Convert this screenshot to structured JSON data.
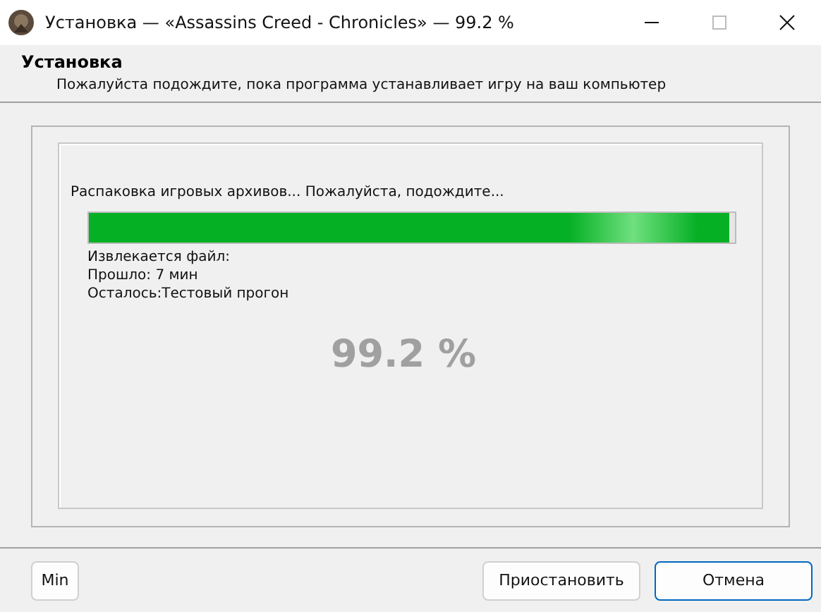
{
  "window": {
    "title": "Установка — «Assassins Creed - Chronicles» — 99.2 %"
  },
  "header": {
    "title": "Установка",
    "subtitle": "Пожалуйста подождите, пока программа устанавливает игру на ваш компьютер"
  },
  "progress": {
    "status": "Распаковка игровых архивов... Пожалуйста, подождите...",
    "level": 0.992,
    "details": [
      "Извлекается файл:",
      "Прошло: 7 мин",
      "Осталось:Тестовый прогон"
    ],
    "percent": "99.2 %"
  },
  "buttons": [
    {
      "label": "Min",
      "kind": "small",
      "default": false
    },
    {
      "label": "Приостановить",
      "kind": "wide",
      "default": false
    },
    {
      "label": "Отмена",
      "kind": "wide",
      "default": true
    }
  ]
}
